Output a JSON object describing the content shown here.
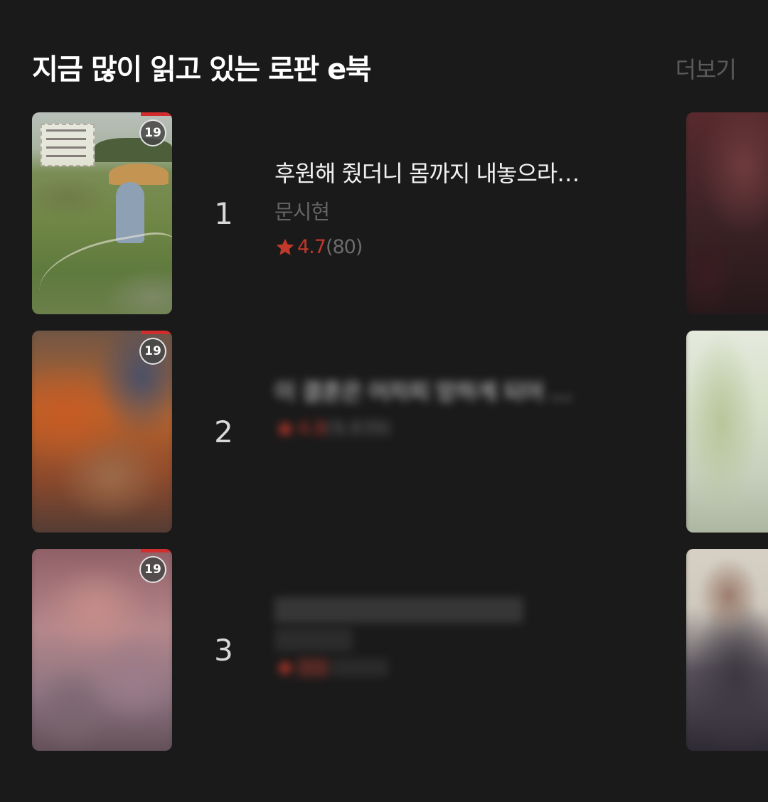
{
  "section": {
    "title": "지금 많이 읽고 있는 로판 e북",
    "more_label": "더보기"
  },
  "books": [
    {
      "rank": "1",
      "title": "후원해 줬더니 몸까지 내놓으라…",
      "author": "문시현",
      "rating": "4.7",
      "rating_count": "(80)",
      "age_badge": "19"
    },
    {
      "rank": "2",
      "title": "이 결혼은 어차피 망하게 되어 …",
      "author": "",
      "rating": "4.8",
      "rating_count": "(9,939)",
      "age_badge": "19"
    },
    {
      "rank": "3",
      "title": "",
      "author": "",
      "rating": "",
      "rating_count": "",
      "age_badge": "19"
    }
  ],
  "colors": {
    "background": "#1a1a1a",
    "star": "#c0392b",
    "author": "#646464",
    "more": "#5b5b5b",
    "age_tag": "#d22d2d"
  },
  "icons": {
    "rating": "star-icon",
    "age": "adult-19-badge-icon"
  }
}
